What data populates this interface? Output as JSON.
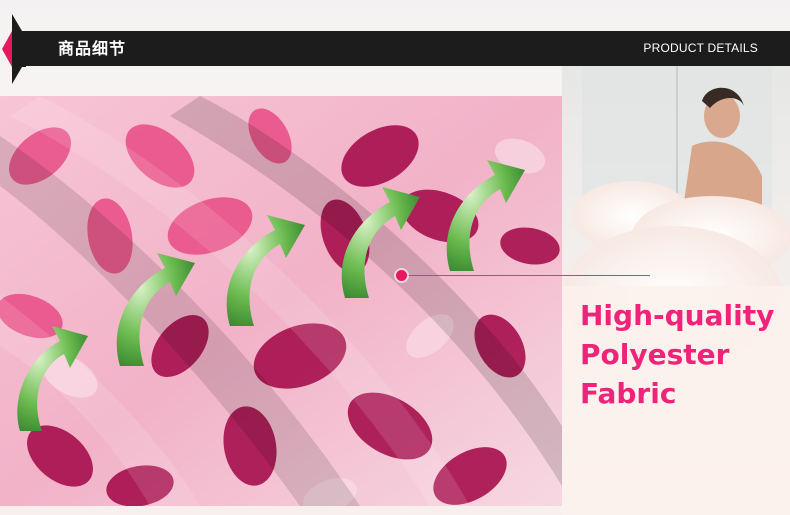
{
  "header": {
    "title": "商品细节",
    "subtitle": "PRODUCT DETAILS"
  },
  "headline": {
    "line1": "High-quality",
    "line2": "Polyester",
    "line3": "Fabric"
  },
  "colors": {
    "accent": "#f0237a",
    "header_bg": "#1c1c1c",
    "marker": "#e8185e",
    "arrow": "#3f9a3a"
  },
  "icons": [
    "curved-arrow-icon",
    "pointer-dot-icon",
    "section-marker-icon"
  ]
}
